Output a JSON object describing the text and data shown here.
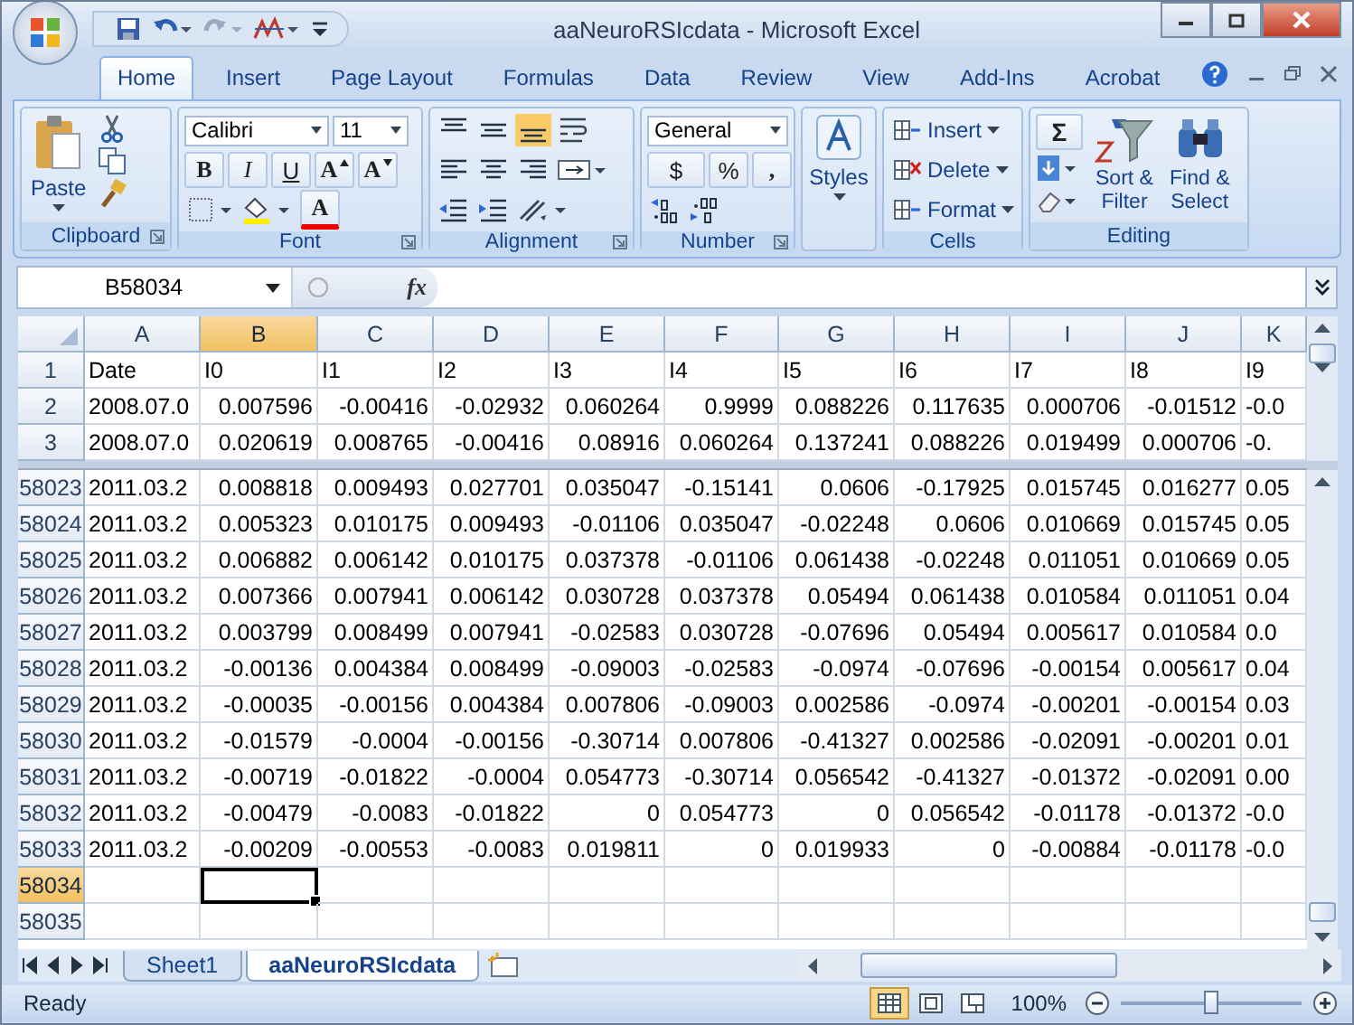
{
  "window": {
    "title": "aaNeuroRSIcdata - Microsoft Excel"
  },
  "ribbon_tabs": [
    {
      "label": "Home",
      "selected": true
    },
    {
      "label": "Insert",
      "selected": false
    },
    {
      "label": "Page Layout",
      "selected": false
    },
    {
      "label": "Formulas",
      "selected": false
    },
    {
      "label": "Data",
      "selected": false
    },
    {
      "label": "Review",
      "selected": false
    },
    {
      "label": "View",
      "selected": false
    },
    {
      "label": "Add-Ins",
      "selected": false
    },
    {
      "label": "Acrobat",
      "selected": false
    }
  ],
  "clipboard": {
    "label": "Clipboard",
    "paste": "Paste"
  },
  "font": {
    "label": "Font",
    "family": "Calibri",
    "size": "11",
    "bold": "B",
    "italic": "I",
    "underline": "U",
    "grow": "A",
    "shrink": "A",
    "font_color": "A"
  },
  "alignment": {
    "label": "Alignment"
  },
  "number": {
    "label": "Number",
    "format": "General",
    "currency": "$",
    "percent": "%",
    "comma": ","
  },
  "styles": {
    "label": "Styles"
  },
  "cells": {
    "label": "Cells",
    "buttons": [
      "Insert",
      "Delete",
      "Format"
    ]
  },
  "editing": {
    "label": "Editing",
    "sum": "Σ",
    "sort": [
      "Sort &",
      "Filter"
    ],
    "find": [
      "Find &",
      "Select"
    ]
  },
  "formula_bar": {
    "name_box": "B58034",
    "function_label": "fx"
  },
  "grid": {
    "columns": [
      {
        "label": "A",
        "selected": false
      },
      {
        "label": "B",
        "selected": true
      },
      {
        "label": "C",
        "selected": false
      },
      {
        "label": "D",
        "selected": false
      },
      {
        "label": "E",
        "selected": false
      },
      {
        "label": "F",
        "selected": false
      },
      {
        "label": "G",
        "selected": false
      },
      {
        "label": "H",
        "selected": false
      },
      {
        "label": "I",
        "selected": false
      },
      {
        "label": "J",
        "selected": false
      },
      {
        "label": "K",
        "selected": false
      }
    ],
    "top_rows": [
      {
        "number": "1",
        "selected": false,
        "kind": "text",
        "cells": [
          "Date",
          "I0",
          "I1",
          "I2",
          "I3",
          "I4",
          "I5",
          "I6",
          "I7",
          "I8",
          "I9"
        ]
      },
      {
        "number": "2",
        "selected": false,
        "kind": "numbers",
        "cells": [
          "2008.07.0",
          "0.007596",
          "-0.00416",
          "-0.02932",
          "0.060264",
          "0.9999",
          "0.088226",
          "0.117635",
          "0.000706",
          "-0.01512",
          "-0.0"
        ]
      },
      {
        "number": "3",
        "selected": false,
        "kind": "numbers",
        "cells": [
          "2008.07.0",
          "0.020619",
          "0.008765",
          "-0.00416",
          "0.08916",
          "0.060264",
          "0.137241",
          "0.088226",
          "0.019499",
          "0.000706",
          "-0."
        ]
      }
    ],
    "bottom_rows": [
      {
        "number": "58023",
        "selected": false,
        "kind": "numbers",
        "cells": [
          "2011.03.2",
          "0.008818",
          "0.009493",
          "0.027701",
          "0.035047",
          "-0.15141",
          "0.0606",
          "-0.17925",
          "0.015745",
          "0.016277",
          "0.05"
        ]
      },
      {
        "number": "58024",
        "selected": false,
        "kind": "numbers",
        "cells": [
          "2011.03.2",
          "0.005323",
          "0.010175",
          "0.009493",
          "-0.01106",
          "0.035047",
          "-0.02248",
          "0.0606",
          "0.010669",
          "0.015745",
          "0.05"
        ]
      },
      {
        "number": "58025",
        "selected": false,
        "kind": "numbers",
        "cells": [
          "2011.03.2",
          "0.006882",
          "0.006142",
          "0.010175",
          "0.037378",
          "-0.01106",
          "0.061438",
          "-0.02248",
          "0.011051",
          "0.010669",
          "0.05"
        ]
      },
      {
        "number": "58026",
        "selected": false,
        "kind": "numbers",
        "cells": [
          "2011.03.2",
          "0.007366",
          "0.007941",
          "0.006142",
          "0.030728",
          "0.037378",
          "0.05494",
          "0.061438",
          "0.010584",
          "0.011051",
          "0.04"
        ]
      },
      {
        "number": "58027",
        "selected": false,
        "kind": "numbers",
        "cells": [
          "2011.03.2",
          "0.003799",
          "0.008499",
          "0.007941",
          "-0.02583",
          "0.030728",
          "-0.07696",
          "0.05494",
          "0.005617",
          "0.010584",
          "0.0"
        ]
      },
      {
        "number": "58028",
        "selected": false,
        "kind": "numbers",
        "cells": [
          "2011.03.2",
          "-0.00136",
          "0.004384",
          "0.008499",
          "-0.09003",
          "-0.02583",
          "-0.0974",
          "-0.07696",
          "-0.00154",
          "0.005617",
          "0.04"
        ]
      },
      {
        "number": "58029",
        "selected": false,
        "kind": "numbers",
        "cells": [
          "2011.03.2",
          "-0.00035",
          "-0.00156",
          "0.004384",
          "0.007806",
          "-0.09003",
          "0.002586",
          "-0.0974",
          "-0.00201",
          "-0.00154",
          "0.03"
        ]
      },
      {
        "number": "58030",
        "selected": false,
        "kind": "numbers",
        "cells": [
          "2011.03.2",
          "-0.01579",
          "-0.0004",
          "-0.00156",
          "-0.30714",
          "0.007806",
          "-0.41327",
          "0.002586",
          "-0.02091",
          "-0.00201",
          "0.01"
        ]
      },
      {
        "number": "58031",
        "selected": false,
        "kind": "numbers",
        "cells": [
          "2011.03.2",
          "-0.00719",
          "-0.01822",
          "-0.0004",
          "0.054773",
          "-0.30714",
          "0.056542",
          "-0.41327",
          "-0.01372",
          "-0.02091",
          "0.00"
        ]
      },
      {
        "number": "58032",
        "selected": false,
        "kind": "numbers",
        "cells": [
          "2011.03.2",
          "-0.00479",
          "-0.0083",
          "-0.01822",
          "0",
          "0.054773",
          "0",
          "0.056542",
          "-0.01178",
          "-0.01372",
          "-0.0"
        ]
      },
      {
        "number": "58033",
        "selected": false,
        "kind": "numbers",
        "cells": [
          "2011.03.2",
          "-0.00209",
          "-0.00553",
          "-0.0083",
          "0.019811",
          "0",
          "0.019933",
          "0",
          "-0.00884",
          "-0.01178",
          "-0.0"
        ]
      },
      {
        "number": "58034",
        "selected": true,
        "kind": "empty"
      },
      {
        "number": "58035",
        "selected": false,
        "kind": "empty"
      }
    ]
  },
  "sheet_tabs": [
    {
      "label": "Sheet1",
      "selected": false
    },
    {
      "label": "aaNeuroRSIcdata",
      "selected": true
    }
  ],
  "status_bar": {
    "status": "Ready",
    "views": [
      {
        "selected": true
      },
      {
        "selected": false
      },
      {
        "selected": false
      }
    ],
    "zoom": "100%",
    "zoom_slider": {
      "level": 0.5
    }
  }
}
